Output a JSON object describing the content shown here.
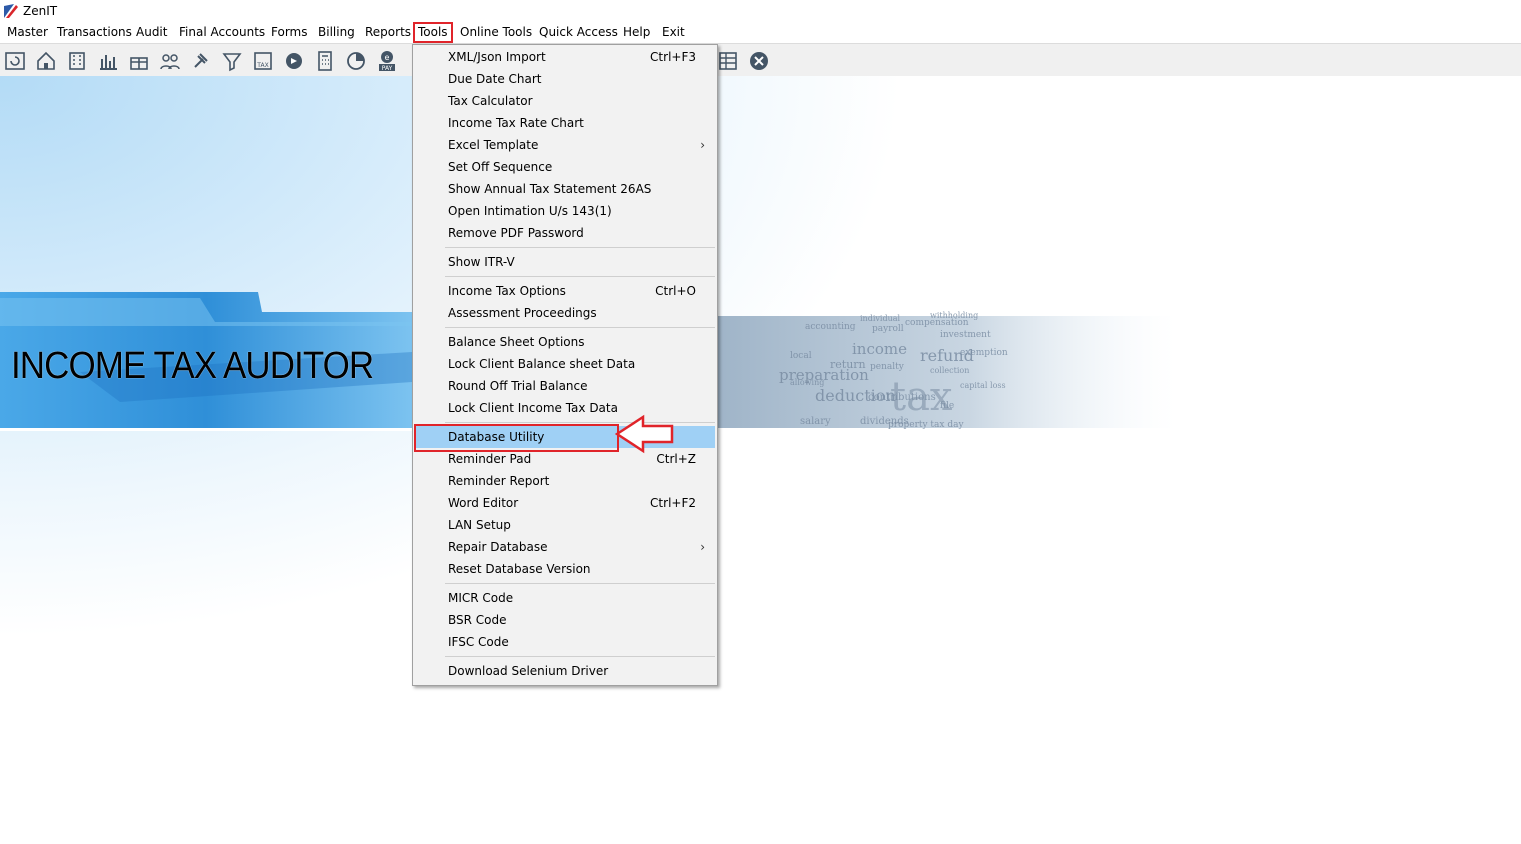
{
  "window": {
    "title": "ZenIT"
  },
  "menubar": [
    {
      "label": "Master"
    },
    {
      "label": "Transactions"
    },
    {
      "label": "Audit"
    },
    {
      "label": "Final Accounts"
    },
    {
      "label": "Forms"
    },
    {
      "label": "Billing"
    },
    {
      "label": "Reports"
    },
    {
      "label": "Tools"
    },
    {
      "label": "Online Tools"
    },
    {
      "label": "Quick Access"
    },
    {
      "label": "Help"
    },
    {
      "label": "Exit"
    }
  ],
  "toolbar_icons": [
    "refresh-icon",
    "home-icon",
    "building-icon",
    "bar-chart-icon",
    "gift-icon",
    "users-icon",
    "gavel-icon",
    "filter-icon",
    "tax-icon",
    "nav-icon",
    "calculator-icon",
    "pie-chart-icon",
    "e-pay-icon",
    "grid-icon",
    "close-circle-icon"
  ],
  "banner": {
    "title": "INCOME TAX AUDITOR",
    "words": [
      "income",
      "refund",
      "preparation",
      "deduction",
      "tax",
      "return",
      "payroll",
      "accounting",
      "individual",
      "penalty",
      "compensation",
      "salary",
      "dividends",
      "property tax day",
      "file",
      "local",
      "investment",
      "exemption",
      "collection",
      "withholding",
      "contributions",
      "allowing",
      "capital loss"
    ]
  },
  "tools_menu": {
    "groups": [
      [
        {
          "label": "XML/Json Import",
          "shortcut": "Ctrl+F3"
        },
        {
          "label": "Due Date Chart",
          "shortcut": ""
        },
        {
          "label": "Tax Calculator",
          "shortcut": ""
        },
        {
          "label": "Income Tax Rate Chart",
          "shortcut": ""
        },
        {
          "label": "Excel Template",
          "shortcut": "",
          "submenu": true
        },
        {
          "label": "Set Off Sequence",
          "shortcut": ""
        },
        {
          "label": "Show Annual Tax Statement 26AS",
          "shortcut": ""
        },
        {
          "label": "Open Intimation U/s 143(1)",
          "shortcut": ""
        },
        {
          "label": "Remove PDF Password",
          "shortcut": ""
        }
      ],
      [
        {
          "label": "Show ITR-V",
          "shortcut": ""
        }
      ],
      [
        {
          "label": "Income Tax Options",
          "shortcut": "Ctrl+O"
        },
        {
          "label": "Assessment Proceedings",
          "shortcut": ""
        }
      ],
      [
        {
          "label": "Balance Sheet Options",
          "shortcut": ""
        },
        {
          "label": "Lock Client Balance sheet Data",
          "shortcut": ""
        },
        {
          "label": "Round Off Trial Balance",
          "shortcut": ""
        },
        {
          "label": "Lock Client Income Tax Data",
          "shortcut": ""
        }
      ],
      [
        {
          "label": "Database Utility",
          "shortcut": "",
          "highlighted": true
        },
        {
          "label": "Reminder Pad",
          "shortcut": "Ctrl+Z"
        },
        {
          "label": "Reminder Report",
          "shortcut": ""
        },
        {
          "label": "Word Editor",
          "shortcut": "Ctrl+F2"
        },
        {
          "label": "LAN Setup",
          "shortcut": ""
        },
        {
          "label": "Repair Database",
          "shortcut": "",
          "submenu": true
        },
        {
          "label": "Reset Database Version",
          "shortcut": ""
        }
      ],
      [
        {
          "label": "MICR Code",
          "shortcut": ""
        },
        {
          "label": "BSR Code",
          "shortcut": ""
        },
        {
          "label": "IFSC Code",
          "shortcut": ""
        }
      ],
      [
        {
          "label": "Download Selenium Driver",
          "shortcut": ""
        }
      ]
    ]
  },
  "colors": {
    "highlight": "#9fd0f5",
    "annotation": "#e0242a",
    "menu_bg": "#f2f2f2"
  }
}
